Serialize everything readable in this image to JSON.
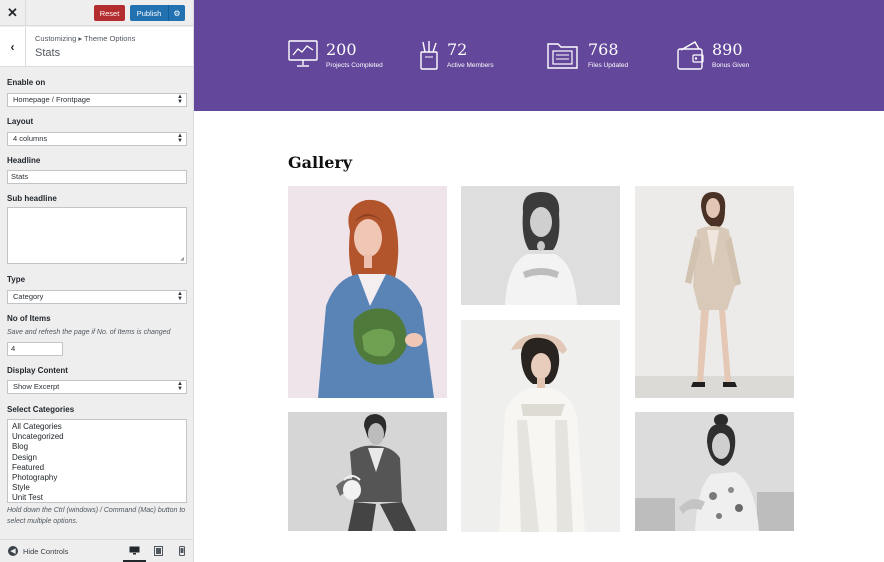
{
  "toolbar": {
    "close_glyph": "✕",
    "reset_label": "Reset",
    "publish_label": "Publish",
    "publish_settings_glyph": "⚙"
  },
  "section": {
    "breadcrumb": "Customizing ▸ Theme Options",
    "title": "Stats",
    "back_glyph": "‹"
  },
  "controls": {
    "enable_on": {
      "label": "Enable on",
      "value": "Homepage / Frontpage"
    },
    "layout": {
      "label": "Layout",
      "value": "4 columns"
    },
    "headline": {
      "label": "Headline",
      "value": "Stats"
    },
    "sub_headline": {
      "label": "Sub headline",
      "value": ""
    },
    "type": {
      "label": "Type",
      "value": "Category"
    },
    "no_of_items": {
      "label": "No of Items",
      "description": "Save and refresh the page if No. of Items is changed",
      "value": "4"
    },
    "display_content": {
      "label": "Display Content",
      "value": "Show Excerpt"
    },
    "select_categories": {
      "label": "Select Categories",
      "options": [
        "All Categories",
        "Uncategorized",
        "Blog",
        "Design",
        "Featured",
        "Photography",
        "Style",
        "Unit Test"
      ],
      "help": "Hold down the Ctrl (windows) / Command (Mac) button to select multiple options."
    }
  },
  "footer": {
    "hide_controls_label": "Hide Controls",
    "devices": [
      "desktop-icon",
      "tablet-icon",
      "mobile-icon"
    ],
    "active_device": "desktop"
  },
  "stats": [
    {
      "icon": "monitor-chart-icon",
      "value": "200",
      "label": "Projects Completed"
    },
    {
      "icon": "pencil-cup-icon",
      "value": "72",
      "label": "Active Members"
    },
    {
      "icon": "folder-icon",
      "value": "768",
      "label": "Files Updated"
    },
    {
      "icon": "wallet-icon",
      "value": "890",
      "label": "Bonus Given"
    }
  ],
  "gallery": {
    "title": "Gallery",
    "photos": [
      {
        "name": "photo-redhead-blue-sweater"
      },
      {
        "name": "photo-woman-white-top"
      },
      {
        "name": "photo-woman-beige-blazer"
      },
      {
        "name": "photo-woman-white-dress"
      },
      {
        "name": "photo-man-with-vase"
      },
      {
        "name": "photo-woman-seated-floral"
      }
    ]
  },
  "colors": {
    "stats_band": "#63479a",
    "reset": "#b32d2e",
    "publish": "#2271b1",
    "sidebar_bg": "#eeeeee"
  }
}
